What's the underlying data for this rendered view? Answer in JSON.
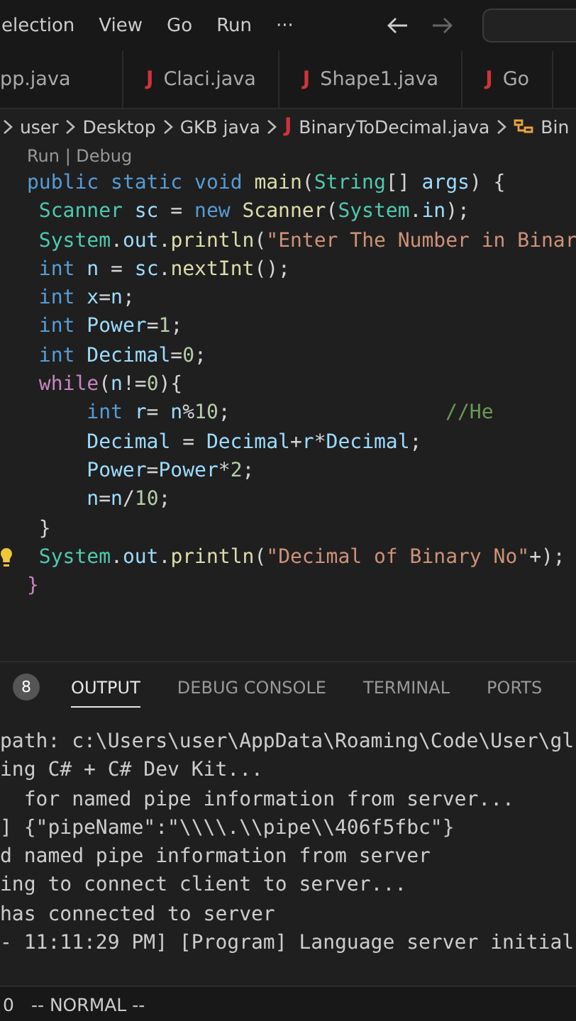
{
  "menu_bar": {
    "items": [
      "election",
      "View",
      "Go",
      "Run",
      "···"
    ],
    "back": {
      "disabled": false
    },
    "forward": {
      "disabled": true
    }
  },
  "tabs": [
    {
      "label": "pp.java",
      "selected": false
    },
    {
      "label": "Claci.java",
      "icon": "J",
      "selected": false
    },
    {
      "label": "Shape1.java",
      "icon": "J",
      "selected": false
    },
    {
      "label": "Go",
      "icon": "J",
      "selected": false
    }
  ],
  "breadcrumb": [
    {
      "label": "user",
      "kind": "folder"
    },
    {
      "label": "Desktop",
      "kind": "folder"
    },
    {
      "label": "GKB java",
      "kind": "folder"
    },
    {
      "label": "BinaryToDecimal.java",
      "kind": "file",
      "icon": "J"
    },
    {
      "label": "Bin",
      "kind": "class"
    }
  ],
  "editor": {
    "codelens": "Run | Debug",
    "lines": [
      [
        {
          "t": "public ",
          "kind": "kw"
        },
        {
          "t": "static ",
          "kind": "kw"
        },
        {
          "t": "void ",
          "kind": "kw"
        },
        {
          "t": "main",
          "kind": "fn"
        },
        {
          "t": "(",
          "kind": "p"
        },
        {
          "t": "String",
          "kind": "type"
        },
        {
          "t": "[] ",
          "kind": "p"
        },
        {
          "t": "args",
          "kind": "var"
        },
        {
          "t": ") {",
          "kind": "p"
        }
      ],
      [
        {
          "t": " Scanner ",
          "kind": "type"
        },
        {
          "t": "sc",
          "kind": "var"
        },
        {
          "t": " = ",
          "kind": "p"
        },
        {
          "t": "new ",
          "kind": "kw"
        },
        {
          "t": "Scanner",
          "kind": "fn"
        },
        {
          "t": "(",
          "kind": "p"
        },
        {
          "t": "System",
          "kind": "type"
        },
        {
          "t": ".",
          "kind": "p"
        },
        {
          "t": "in",
          "kind": "var"
        },
        {
          "t": ");",
          "kind": "p"
        }
      ],
      [
        {
          "t": " System",
          "kind": "type"
        },
        {
          "t": ".",
          "kind": "p"
        },
        {
          "t": "out",
          "kind": "var"
        },
        {
          "t": ".",
          "kind": "p"
        },
        {
          "t": "println",
          "kind": "fn"
        },
        {
          "t": "(",
          "kind": "p"
        },
        {
          "t": "\"Enter The Number in Binar",
          "kind": "str"
        }
      ],
      [
        {
          "t": " int ",
          "kind": "kw"
        },
        {
          "t": "n",
          "kind": "var"
        },
        {
          "t": " = ",
          "kind": "p"
        },
        {
          "t": "sc",
          "kind": "var"
        },
        {
          "t": ".",
          "kind": "p"
        },
        {
          "t": "nextInt",
          "kind": "fn"
        },
        {
          "t": "();",
          "kind": "p"
        }
      ],
      [
        {
          "t": " int ",
          "kind": "kw"
        },
        {
          "t": "x",
          "kind": "var"
        },
        {
          "t": "=",
          "kind": "p"
        },
        {
          "t": "n",
          "kind": "var"
        },
        {
          "t": ";",
          "kind": "p"
        }
      ],
      [
        {
          "t": " int ",
          "kind": "kw"
        },
        {
          "t": "Power",
          "kind": "var"
        },
        {
          "t": "=",
          "kind": "p"
        },
        {
          "t": "1",
          "kind": "num"
        },
        {
          "t": ";",
          "kind": "p"
        }
      ],
      [
        {
          "t": " int ",
          "kind": "kw"
        },
        {
          "t": "Decimal",
          "kind": "var"
        },
        {
          "t": "=",
          "kind": "p"
        },
        {
          "t": "0",
          "kind": "num"
        },
        {
          "t": ";",
          "kind": "p"
        }
      ],
      [
        {
          "t": " while",
          "kind": "ctl"
        },
        {
          "t": "(",
          "kind": "p"
        },
        {
          "t": "n",
          "kind": "var"
        },
        {
          "t": "!=",
          "kind": "p"
        },
        {
          "t": "0",
          "kind": "num"
        },
        {
          "t": "){",
          "kind": "p"
        }
      ],
      [
        {
          "t": "     int ",
          "kind": "kw"
        },
        {
          "t": "r",
          "kind": "var"
        },
        {
          "t": "= ",
          "kind": "p"
        },
        {
          "t": "n",
          "kind": "var"
        },
        {
          "t": "%",
          "kind": "p"
        },
        {
          "t": "10",
          "kind": "num"
        },
        {
          "t": ";                  ",
          "kind": "p"
        },
        {
          "t": "//He",
          "kind": "cmt"
        }
      ],
      [
        {
          "t": "     Decimal",
          "kind": "var"
        },
        {
          "t": " = ",
          "kind": "p"
        },
        {
          "t": "Decimal",
          "kind": "var"
        },
        {
          "t": "+",
          "kind": "p"
        },
        {
          "t": "r",
          "kind": "var"
        },
        {
          "t": "*",
          "kind": "p"
        },
        {
          "t": "Decimal",
          "kind": "var"
        },
        {
          "t": ";",
          "kind": "p"
        }
      ],
      [
        {
          "t": "     Power",
          "kind": "var"
        },
        {
          "t": "=",
          "kind": "p"
        },
        {
          "t": "Power",
          "kind": "var"
        },
        {
          "t": "*",
          "kind": "p"
        },
        {
          "t": "2",
          "kind": "num"
        },
        {
          "t": ";",
          "kind": "p"
        }
      ],
      [
        {
          "t": "     n",
          "kind": "var"
        },
        {
          "t": "=",
          "kind": "p"
        },
        {
          "t": "n",
          "kind": "var"
        },
        {
          "t": "/",
          "kind": "p"
        },
        {
          "t": "10",
          "kind": "num"
        },
        {
          "t": ";",
          "kind": "p"
        }
      ],
      [
        {
          "t": " }",
          "kind": "p"
        }
      ],
      [
        {
          "t": " System",
          "kind": "type"
        },
        {
          "t": ".",
          "kind": "p"
        },
        {
          "t": "out",
          "kind": "var"
        },
        {
          "t": ".",
          "kind": "p"
        },
        {
          "t": "println",
          "kind": "fn"
        },
        {
          "t": "(",
          "kind": "p"
        },
        {
          "t": "\"Decimal of Binary No\"",
          "kind": "str"
        },
        {
          "t": "+);",
          "kind": "p"
        }
      ],
      [
        {
          "t": "}",
          "kind": "brace"
        }
      ]
    ]
  },
  "panel": {
    "badge": "8",
    "tabs": [
      {
        "label": "OUTPUT",
        "selected": true
      },
      {
        "label": "DEBUG CONSOLE",
        "selected": false
      },
      {
        "label": "TERMINAL",
        "selected": false
      },
      {
        "label": "PORTS",
        "selected": false
      }
    ],
    "output": [
      "path: c:\\Users\\user\\AppData\\Roaming\\Code\\User\\gl",
      "ing C# + C# Dev Kit...",
      "  for named pipe information from server...",
      "] {\"pipeName\":\"\\\\\\\\.\\\\pipe\\\\406f5fbc\"}",
      "d named pipe information from server",
      "ing to connect client to server...",
      "has connected to server",
      "- 11:11:29 PM] [Program] Language server initial"
    ]
  },
  "status_bar": {
    "items": [
      "0",
      "-- NORMAL --"
    ]
  }
}
